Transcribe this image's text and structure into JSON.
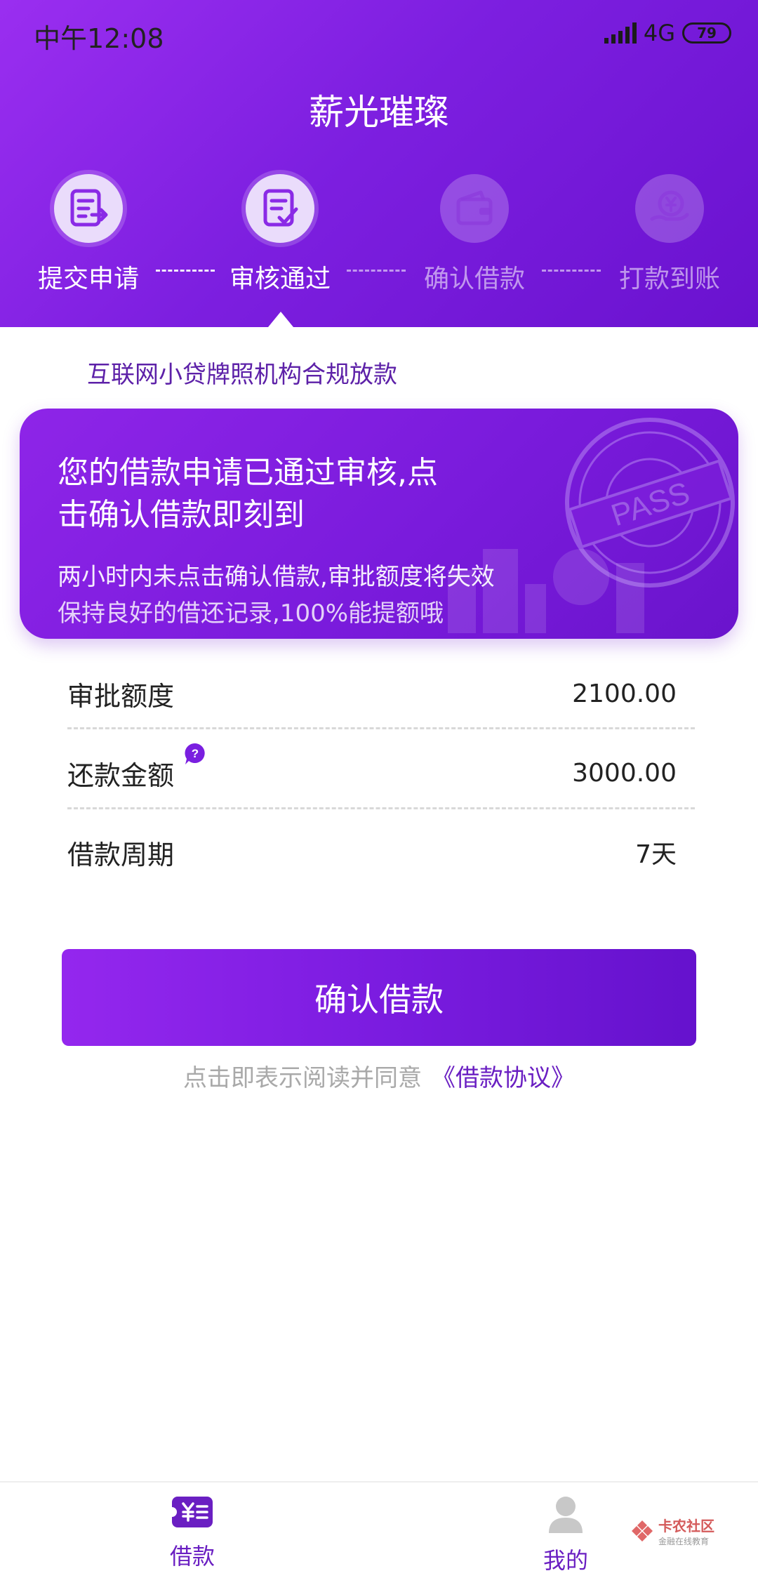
{
  "status_bar": {
    "time": "中午12:08",
    "network": "4G",
    "battery": "79"
  },
  "header": {
    "title": "薪光璀璨"
  },
  "steps": [
    {
      "label": "提交申请",
      "icon": "document-submit-icon",
      "state": "done"
    },
    {
      "label": "审核通过",
      "icon": "document-check-icon",
      "state": "current"
    },
    {
      "label": "确认借款",
      "icon": "wallet-icon",
      "state": "pending"
    },
    {
      "label": "打款到账",
      "icon": "yuan-coin-hand-icon",
      "state": "pending"
    }
  ],
  "notice": "互联网小贷牌照机构合规放款",
  "card": {
    "title": "您的借款申请已通过审核,点击确认借款即刻到",
    "line1": "两小时内未点击确认借款,审批额度将失效",
    "line2": "保持良好的借还记录,100%能提额哦",
    "stamp_text": "PASS"
  },
  "details": [
    {
      "label": "审批额度",
      "value": "2100.00"
    },
    {
      "label": "还款金额",
      "value": "3000.00",
      "help": "?"
    },
    {
      "label": "借款周期",
      "value": "7天"
    }
  ],
  "confirm_button": "确认借款",
  "agreement": {
    "text": "点击即表示阅读并同意",
    "link": "《借款协议》"
  },
  "bottom_nav": [
    {
      "label": "借款",
      "icon": "loan-yuan-icon",
      "active": true
    },
    {
      "label": "我的",
      "icon": "profile-icon",
      "active": false
    }
  ],
  "watermark": {
    "name": "卡农社区",
    "sub": "金融在线教育"
  },
  "colors": {
    "brand": "#7d1fe0",
    "link": "#6a1fc2",
    "muted": "#a9a9a9"
  }
}
